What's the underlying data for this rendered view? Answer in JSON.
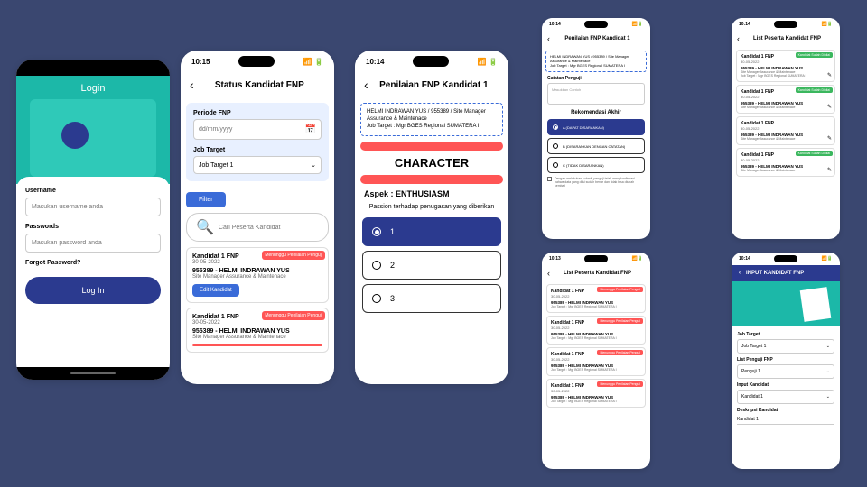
{
  "time1": "10:15",
  "time2": "10:14",
  "time3": "10:14",
  "time4": "10:14",
  "time5": "10:13",
  "login": {
    "title": "Login",
    "username_label": "Username",
    "username_ph": "Masukan username anda",
    "password_label": "Passwords",
    "password_ph": "Masukan password anda",
    "forgot": "Forgot Password?",
    "btn": "Log In"
  },
  "status": {
    "title": "Status Kandidat FNP",
    "periode_label": "Periode FNP",
    "periode_ph": "dd/mm/yyyy",
    "jt_label": "Job Target",
    "jt_value": "Job Target 1",
    "filter_btn": "Filter",
    "search_ph": "Cari Peserta Kandidat",
    "c1_name": "Kandidat 1 FNP",
    "c1_date": "30-05-2022",
    "c1_badge": "Menunggu Penilaian Penguji",
    "c1_sub": "955389 - HELMI INDRAWAN YUS",
    "c1_subd": "Site Manager Assurance & Maintenace",
    "edit_btn": "Edit Kandidat",
    "c2_name": "Kandidat 1 FNP",
    "c2_date": "30-05-2022",
    "c2_badge": "Menunggu Penilaian Penguji",
    "c2_sub": "955389 - HELMI INDRAWAN YUS",
    "c2_subd": "Site Manager Assurance & Maintenace"
  },
  "penilaian": {
    "title": "Penilaian FNP Kandidat 1",
    "info1": "HELMI INDRAWAN YUS / 955389 / Site Manager Assurance & Maintenace",
    "info2": "Job Target : Mgr BGES Regional SUMATERA I",
    "ch": "CHARACTER",
    "aspek": "Aspek : ENTHUSIASM",
    "desc": "Passion terhadap penugasan yang diberikan",
    "o1": "1",
    "o2": "2",
    "o3": "3"
  },
  "rek": {
    "title": "Penilaian FNP Kandidat 1",
    "info1": "HELMI INDRAWAN YUS / 955389 / Site Manager Assurance & Maintenace",
    "info2": "Job Target : Mgr BGES Regional SUMATERA I",
    "catatan": "Catatan Penguji",
    "catatan_ph": "Masukkan Contoh",
    "rektitle": "Rekomendasi Akhir",
    "a": "A (DAPAT DISARANKAN)",
    "b": "B (DISARANKAN DENGAN CATATAN)",
    "c": "C (TIDAK DISARANKAN)",
    "note": "Dengan melakukan submit, penguji telah mengkonfirmasi bahwa data yang diisi sudah benar dan tidak bisa diubah kembali"
  },
  "list1": {
    "title": "List Peserta Kandidat FNP",
    "name": "Kandidat 1 FNP",
    "date": "30-05-2022",
    "badge_done": "Kandidat Sudah Dinilai",
    "sub": "955389 - HELMI INDRAWAN YUS",
    "subd": "Site Manager Assurance & Maintenace",
    "subd2": "Job Target : Mgr BGES Regional SUMATERA I"
  },
  "list2": {
    "title": "List Peserta Kandidat FNP",
    "badge_wait": "Menunggu Penilaian Penguji"
  },
  "input": {
    "title": "INPUT KANDIDAT FNP",
    "jt_label": "Job Target",
    "jt_value": "Job Target 1",
    "lp_label": "List Penguji FNP",
    "lp_value": "Penguji 1",
    "ik_label": "Input Kandidat",
    "ik_value": "Kandidat 1",
    "dk_label": "Deskripsi Kandidat",
    "dk_value": "Kandidat 1"
  }
}
